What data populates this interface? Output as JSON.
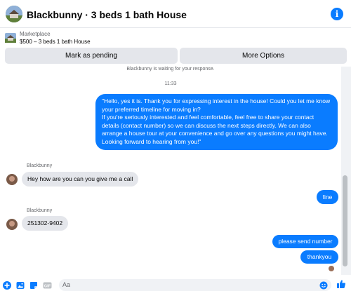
{
  "header": {
    "title": "Blackbunny · 3 beds 1 bath House",
    "info_icon": "info-icon",
    "accent": "#0a7cff"
  },
  "marketplace": {
    "label": "Marketplace",
    "listing": "$500 – 3 beds 1 bath House",
    "pending_button": "Mark as pending",
    "more_button": "More Options"
  },
  "thread": {
    "status_text": "Blackbunny is waiting for your response.",
    "timestamp": "11:33",
    "outgoing_long": [
      "\"Hello, yes it is. Thank you for expressing interest in the house! Could you let me know your preferred timeline for moving in?",
      "If you're seriously interested and feel comfortable, feel free to share your contact details (contact number) so we can discuss the next steps directly. We can also arrange a house tour at your convenience and go over any questions you might have.",
      "Looking forward to hearing from you!\""
    ],
    "incoming_1": {
      "sender": "Blackbunny",
      "text": "Hey how are you can you give me a call"
    },
    "outgoing_fine": "fine",
    "incoming_2": {
      "sender": "Blackbunny",
      "text": "251302-9402"
    },
    "outgoing_send_number": "please send number",
    "outgoing_thanks": "thankyou"
  },
  "composer": {
    "placeholder": "Aa",
    "icons": [
      "plus-icon",
      "image-icon",
      "sticker-icon",
      "gif-icon",
      "emoji-icon",
      "like-icon"
    ]
  }
}
